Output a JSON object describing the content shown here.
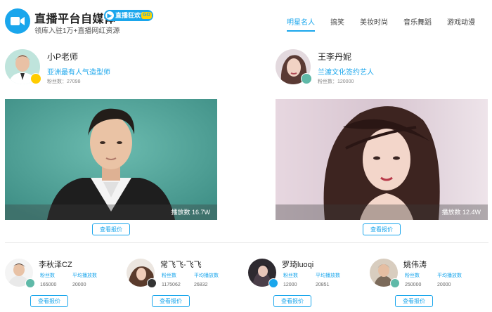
{
  "header": {
    "title": "直播平台自媒体",
    "badge": "直播狂欢节",
    "badge_go": "GO",
    "subtitle": "领库入驻1万+直播网红资源",
    "logo_icon": "video-camera-icon"
  },
  "nav": {
    "tabs": [
      {
        "label": "明星名人",
        "active": true
      },
      {
        "label": "搞笑",
        "active": false
      },
      {
        "label": "美妆时尚",
        "active": false
      },
      {
        "label": "音乐舞蹈",
        "active": false
      },
      {
        "label": "游戏动漫",
        "active": false
      }
    ]
  },
  "featured": [
    {
      "name": "小P老师",
      "tag": "亚洲最有人气造型师",
      "fans": "粉丝数：27098",
      "plays": "播放数  16.7W",
      "quote": "查看报价"
    },
    {
      "name": "王李丹妮",
      "tag": "兰渡文化签约艺人",
      "fans": "粉丝数：120000",
      "plays": "播放数  12.4W",
      "quote": "查看报价"
    }
  ],
  "influencers": [
    {
      "name": "李秋泽CZ",
      "fans_label": "粉丝数",
      "plays_label": "平均播放数",
      "fans": "165000",
      "plays": "20000",
      "quote": "查看报价"
    },
    {
      "name": "常飞飞-飞飞",
      "fans_label": "粉丝数",
      "plays_label": "平均播放数",
      "fans": "1175062",
      "plays": "26832",
      "quote": "查看报价"
    },
    {
      "name": "罗琦luoqi",
      "fans_label": "粉丝数",
      "plays_label": "平均播放数",
      "fans": "12000",
      "plays": "20851",
      "quote": "查看报价"
    },
    {
      "name": "姚伟涛",
      "fans_label": "粉丝数",
      "plays_label": "平均播放数",
      "fans": "250000",
      "plays": "20000",
      "quote": "查看报价"
    }
  ],
  "colors": {
    "accent": "#1aa6ec",
    "cover_left_bg": "#4fa49a",
    "cover_right_bg": "#e8dce4"
  }
}
